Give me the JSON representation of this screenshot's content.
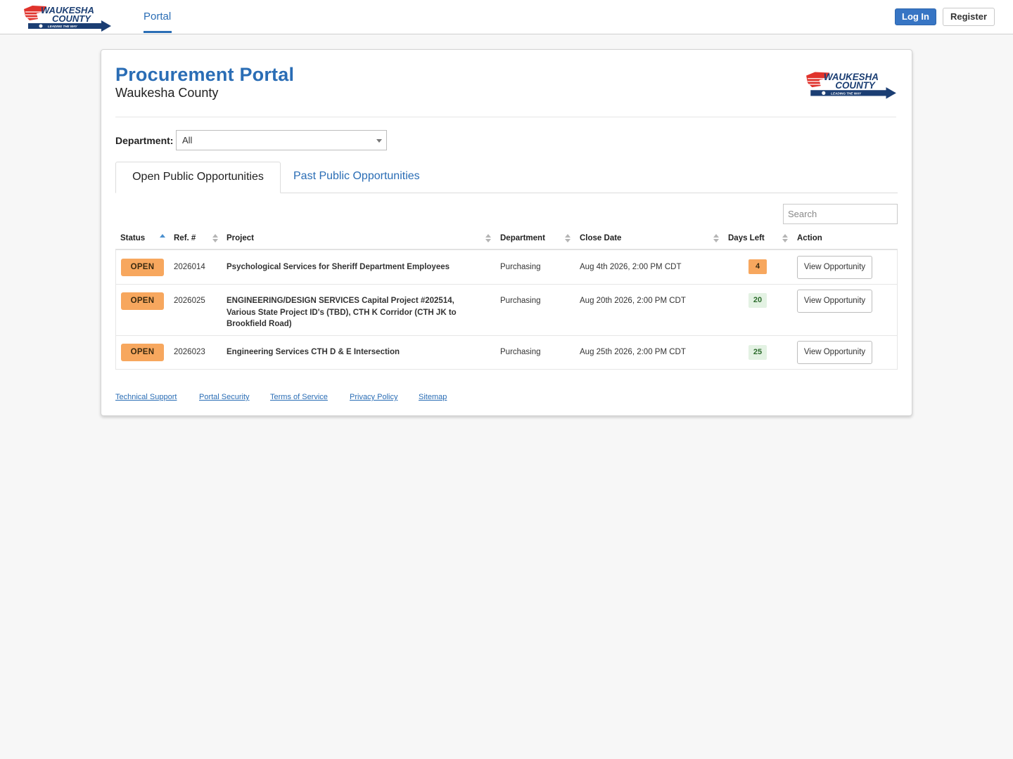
{
  "nav": {
    "logo_alt": "Waukesha County - Leading the Way",
    "portal_link": "Portal",
    "login_label": "Log In",
    "register_label": "Register"
  },
  "header": {
    "title": "Procurement Portal",
    "subtitle": "Waukesha County"
  },
  "filter": {
    "label": "Department:",
    "selected": "All"
  },
  "tabs": [
    {
      "label": "Open Public Opportunities",
      "active": true
    },
    {
      "label": "Past Public Opportunities",
      "active": false
    }
  ],
  "search": {
    "placeholder": "Search"
  },
  "table": {
    "columns": [
      "Status",
      "Ref. #",
      "Project",
      "Department",
      "Close Date",
      "Days Left",
      "Action"
    ],
    "rows": [
      {
        "status": "OPEN",
        "ref": "2026014",
        "project": "Psychological Services for Sheriff Department Employees",
        "department": "Purchasing",
        "close_date": "Aug 4th 2026, 2:00 PM CDT",
        "days_left": "4",
        "action": "View Opportunity"
      },
      {
        "status": "OPEN",
        "ref": "2026025",
        "project": "ENGINEERING/DESIGN SERVICES Capital Project #202514, Various State Project ID's (TBD), CTH K Corridor (CTH JK to Brookfield Road)",
        "department": "Purchasing",
        "close_date": "Aug 20th 2026, 2:00 PM CDT",
        "days_left": "20",
        "action": "View Opportunity"
      },
      {
        "status": "OPEN",
        "ref": "2026023",
        "project": "Engineering Services CTH D & E Intersection",
        "department": "Purchasing",
        "close_date": "Aug 25th 2026, 2:00 PM CDT",
        "days_left": "25",
        "action": "View Opportunity"
      }
    ]
  },
  "footer": {
    "links": [
      "Technical Support",
      "Portal Security",
      "Terms of Service",
      "Privacy Policy",
      "Sitemap"
    ]
  },
  "colors": {
    "brand_blue": "#2a6db5",
    "status_open": "#f7a75e",
    "days_ok_bg": "#e3f2e3",
    "logo_red": "#e0332c",
    "logo_navy": "#1b3e73"
  }
}
